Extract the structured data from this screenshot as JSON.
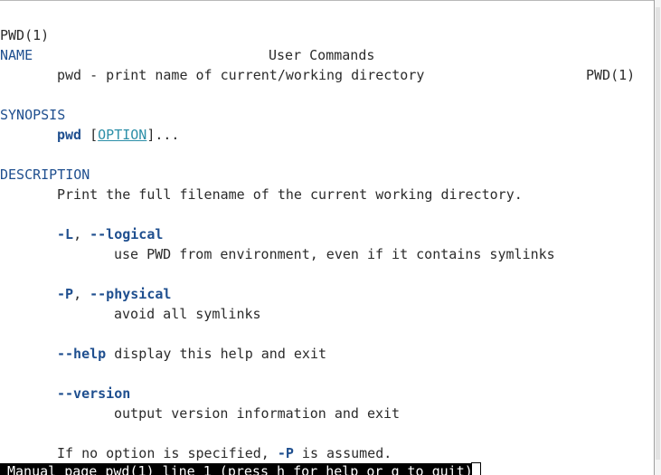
{
  "header": {
    "left": "PWD(1)",
    "center": "User Commands",
    "right": "PWD(1)"
  },
  "sections": {
    "name": {
      "heading": "NAME",
      "text": "pwd - print name of current/working directory"
    },
    "synopsis": {
      "heading": "SYNOPSIS",
      "command": "pwd",
      "bracket_open": " [",
      "option": "OPTION",
      "bracket_close": "]..."
    },
    "description": {
      "heading": "DESCRIPTION",
      "intro": "Print the full filename of the current working directory.",
      "options": [
        {
          "short": "-L",
          "sep": ", ",
          "long": "--logical",
          "desc": "use PWD from environment, even if it contains symlinks"
        },
        {
          "short": "-P",
          "sep": ", ",
          "long": "--physical",
          "desc": "avoid all symlinks"
        },
        {
          "long": "--help",
          "inline_desc": " display this help and exit"
        },
        {
          "long": "--version",
          "desc": "output version information and exit"
        }
      ],
      "footer_prefix": "If no option is specified, ",
      "footer_flag": "-P",
      "footer_suffix": " is assumed."
    }
  },
  "status_bar": {
    "text": "Manual page pwd(1) line 1 (press h for help or q to quit)"
  },
  "colors": {
    "heading": "#1f4f8f",
    "underline_option": "#2c8fa8",
    "status_bg": "#000000",
    "status_fg": "#ffffff"
  }
}
